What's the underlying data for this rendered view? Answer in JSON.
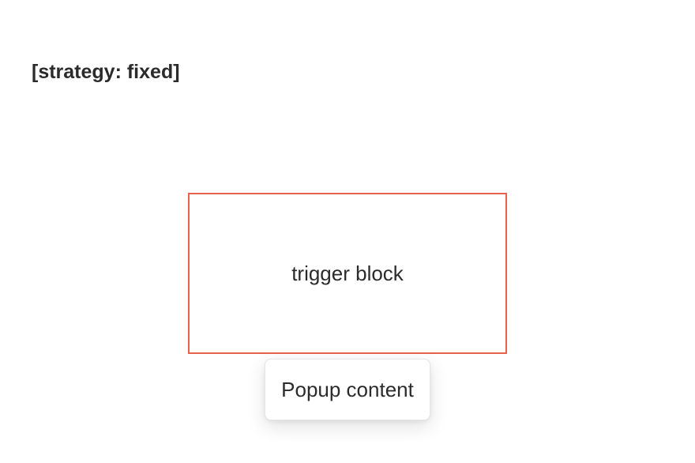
{
  "heading": {
    "text": "[strategy: fixed]"
  },
  "trigger": {
    "label": "trigger block",
    "border_color": "#e8614d"
  },
  "popup": {
    "content": "Popup content"
  }
}
